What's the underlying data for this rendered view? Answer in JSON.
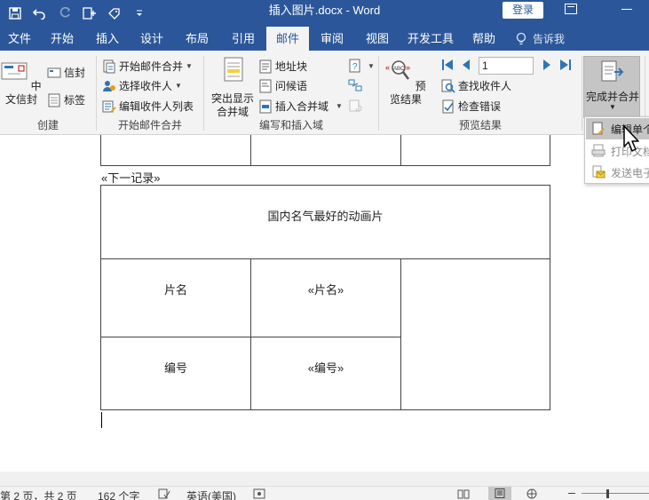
{
  "titlebar": {
    "title": "插入图片.docx  -  Word",
    "login_label": "登录",
    "quick_access": [
      "save-icon",
      "undo-icon",
      "redo-icon",
      "new-doc-icon",
      "touch-mode-icon",
      "customize-icon"
    ]
  },
  "tabs": [
    {
      "label": "文件"
    },
    {
      "label": "开始"
    },
    {
      "label": "插入"
    },
    {
      "label": "设计"
    },
    {
      "label": "布局"
    },
    {
      "label": "引用"
    },
    {
      "label": "邮件"
    },
    {
      "label": "审阅"
    },
    {
      "label": "视图"
    },
    {
      "label": "开发工具"
    },
    {
      "label": "帮助"
    }
  ],
  "active_tab": "邮件",
  "tell_me": "告诉我",
  "ribbon": {
    "create": {
      "label": "创建",
      "chinese_envelope": "中文信封",
      "envelopes": "信封",
      "labels": "标签"
    },
    "start_merge": {
      "label": "开始邮件合并",
      "start": "开始邮件合并",
      "select_recipients": "选择收件人",
      "edit_recipients": "编辑收件人列表"
    },
    "write_insert": {
      "label": "编写和插入域",
      "highlight_line1": "突出显示",
      "highlight_line2": "合并域",
      "address_block": "地址块",
      "greeting_line": "问候语",
      "insert_merge_field": "插入合并域"
    },
    "preview": {
      "label": "预览结果",
      "preview_results": "预览结果",
      "record_value": "1",
      "find_recipient": "查找收件人",
      "check_errors": "检查错误"
    },
    "finish": {
      "label": "完成并合并"
    }
  },
  "dropdown": {
    "items": [
      {
        "label": "编辑单个文档"
      },
      {
        "label": "打印文档"
      },
      {
        "label": "发送电子邮件"
      }
    ]
  },
  "document": {
    "next_record": "«下一记录»",
    "table_title": "国内名气最好的动画片",
    "row1_label": "片名",
    "row1_field": "«片名»",
    "row2_label": "编号",
    "row2_field": "«编号»"
  },
  "statusbar": {
    "page": "第 2 页，共 2 页",
    "words": "162 个字",
    "language": "英语(美国)"
  },
  "colors": {
    "word_blue": "#2b579a",
    "ribbon_bg": "#f3f3f3",
    "accent_icon": "#2e75b6",
    "hover_gray": "#c5c5c5"
  }
}
